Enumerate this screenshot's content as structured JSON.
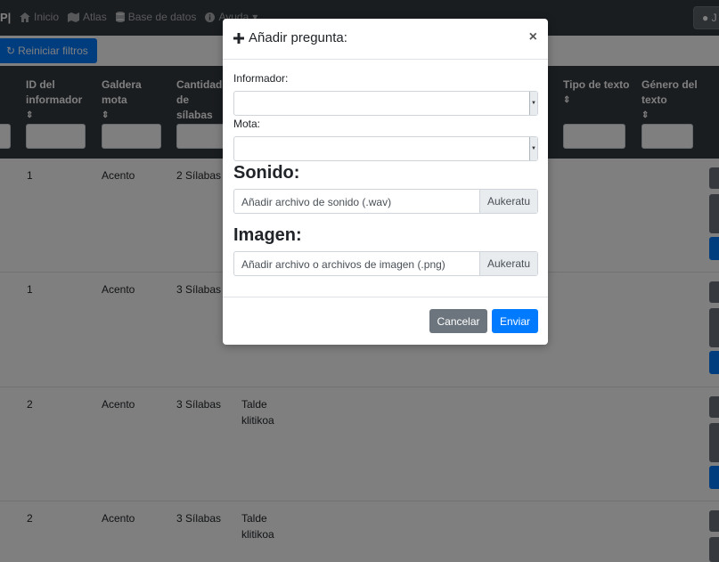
{
  "navbar": {
    "brand": "P|",
    "items": [
      {
        "icon": "home-icon",
        "label": "Inicio"
      },
      {
        "icon": "map-icon",
        "label": "Atlas"
      },
      {
        "icon": "database-icon",
        "label": "Base de datos"
      },
      {
        "icon": "info-icon",
        "label": "Ayuda"
      }
    ],
    "user": "J"
  },
  "toolbar": {
    "reset_label": "Reiniciar filtros"
  },
  "table": {
    "headers": [
      {
        "label": "ID del informador",
        "sort": "⇕"
      },
      {
        "label": "Galdera mota",
        "sort": "⇕"
      },
      {
        "label": "Cantidad de sílabas",
        "sort": "⇕"
      },
      {
        "label": "Tipo de texto",
        "sort": "⇕"
      },
      {
        "label": "Género del texto",
        "sort": "⇕"
      }
    ],
    "rows": [
      {
        "id": "1",
        "type": "Acento",
        "syllables": "2 Sílabas",
        "group": ""
      },
      {
        "id": "1",
        "type": "Acento",
        "syllables": "3 Sílabas",
        "group": ""
      },
      {
        "id": "2",
        "type": "Acento",
        "syllables": "3 Sílabas",
        "group": "Talde klitikoa"
      },
      {
        "id": "2",
        "type": "Acento",
        "syllables": "3 Sílabas",
        "group": "Talde klitikoa"
      }
    ]
  },
  "modal": {
    "title": "Añadir pregunta:",
    "close": "×",
    "informador_label": "Informador:",
    "mota_label": "Mota:",
    "sound_title": "Sonido:",
    "sound_placeholder": "Añadir archivo de sonido (.wav)",
    "sound_button": "Aukeratu",
    "image_title": "Imagen:",
    "image_placeholder": "Añadir archivo o archivos de imagen (.png)",
    "image_button": "Aukeratu",
    "cancel_label": "Cancelar",
    "submit_label": "Enviar"
  },
  "colors": {
    "primary": "#007bff",
    "secondary": "#6c757d",
    "dark": "#343a40"
  }
}
